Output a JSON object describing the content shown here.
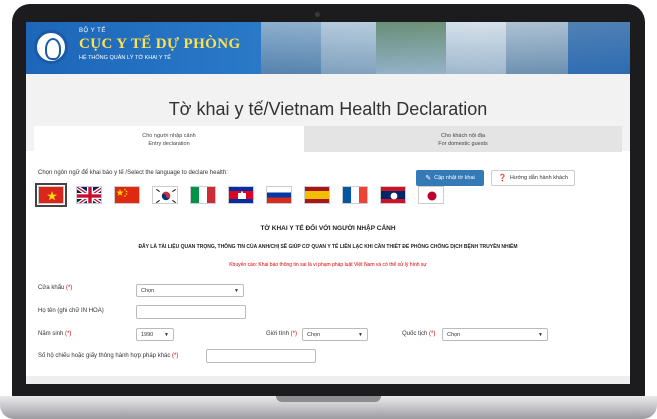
{
  "header": {
    "org_sup": "BỘ Y TẾ",
    "org_name": "CỤC Y TẾ DỰ PHÒNG",
    "org_sub": "HỆ THỐNG QUẢN LÝ TỜ KHAI Y TẾ"
  },
  "page_title": "Tờ khai y tế/Vietnam Health Declaration",
  "tabs": [
    {
      "label_vi": "Cho người nhập cảnh",
      "label_en": "Entry declaration",
      "active": true
    },
    {
      "label_vi": "Cho khách nội địa",
      "label_en": "For domestic guests",
      "active": false
    }
  ],
  "language": {
    "prompt": "Chọn ngôn ngữ để khai báo y tế /Select the language to declare health:",
    "flags": [
      "vietnam-flag",
      "uk-flag",
      "china-flag",
      "korea-flag",
      "italy-flag",
      "cambodia-flag",
      "russia-flag",
      "spain-flag",
      "france-flag",
      "laos-flag",
      "japan-flag"
    ]
  },
  "buttons": {
    "update": "Cập nhật tờ khai",
    "guide": "Hướng dẫn hành khách"
  },
  "form": {
    "heading": "TỜ KHAI Y TẾ ĐỐI VỚI NGƯỜI NHẬP CẢNH",
    "notice": "ĐÂY LÀ TÀI LIỆU QUAN TRỌNG, THÔNG TIN CỦA ANH/CHỊ SẼ GIÚP CƠ QUAN Y TẾ LIÊN LẠC KHI CẦN THIẾT ĐỂ PHÒNG CHỐNG DỊCH BỆNH TRUYỀN NHIỄM",
    "warning": "Khuyến cáo: Khai báo thông tin sai là vi phạm pháp luật Việt Nam và có thể xử lý hình sự",
    "border_gate_label": "Cửa khẩu",
    "border_gate_value": "Chọn",
    "full_name_label": "Họ tên (ghi chữ IN HOA)",
    "birth_year_label": "Năm sinh",
    "birth_year_value": "1990",
    "gender_label": "Giới tính",
    "gender_value": "Chọn",
    "nationality_label": "Quốc tịch",
    "nationality_value": "Chọn",
    "passport_label": "Số hộ chiếu hoặc giấy thông hành hợp pháp khác",
    "required_mark": "(*)"
  },
  "colors": {
    "primary": "#337ab7",
    "banner": "#1d66b8",
    "title_bg": "#f2f2f2",
    "required": "#dd0000",
    "org_name": "#ffe14d"
  }
}
